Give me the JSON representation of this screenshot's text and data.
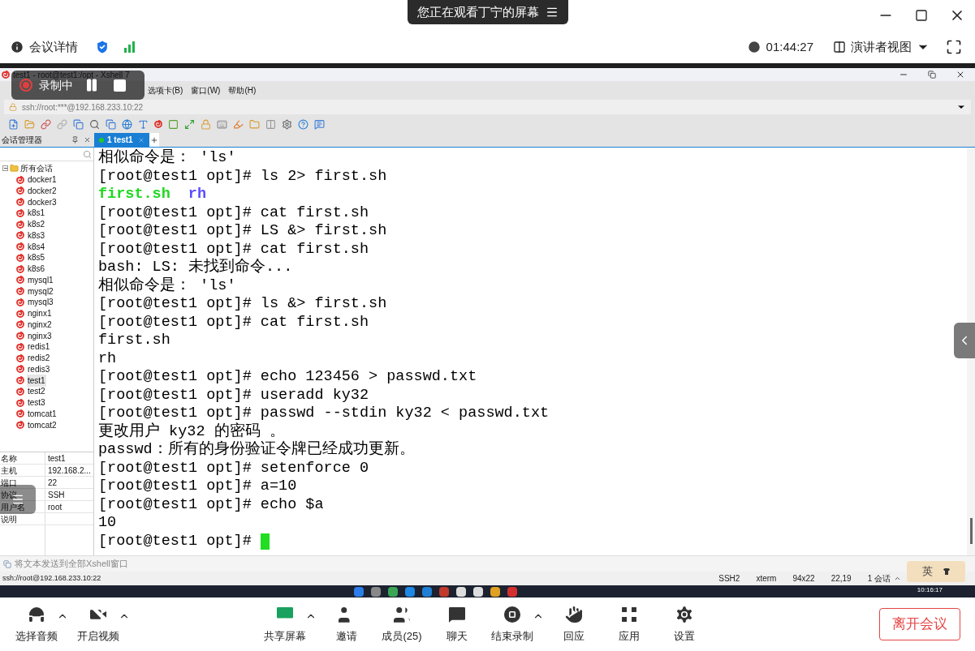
{
  "meeting": {
    "banner": "您正在观看丁宁的屏幕",
    "info": "会议详情",
    "clock": "01:44:27",
    "view": "演讲者视图"
  },
  "recording": {
    "label": "录制中"
  },
  "xshell": {
    "title": "test1 - root@test1:/opt - Xshell 7",
    "menu": [
      "选项卡(B)",
      "窗口(W)",
      "帮助(H)"
    ],
    "address": "ssh://root:***@192.168.233.10:22",
    "sessions_panel": {
      "title": "会话管理器",
      "root": {
        "label": "所有会话",
        "expanded": true,
        "children": [
          {
            "label": "docker1",
            "selected": false
          },
          {
            "label": "docker2",
            "selected": false
          },
          {
            "label": "docker3",
            "selected": false
          },
          {
            "label": "k8s1",
            "selected": false
          },
          {
            "label": "k8s2",
            "selected": false
          },
          {
            "label": "k8s3",
            "selected": false
          },
          {
            "label": "k8s4",
            "selected": false
          },
          {
            "label": "k8s5",
            "selected": false
          },
          {
            "label": "k8s6",
            "selected": false
          },
          {
            "label": "mysql1",
            "selected": false
          },
          {
            "label": "mysql2",
            "selected": false
          },
          {
            "label": "mysql3",
            "selected": false
          },
          {
            "label": "nginx1",
            "selected": false
          },
          {
            "label": "nginx2",
            "selected": false
          },
          {
            "label": "nginx3",
            "selected": false
          },
          {
            "label": "redis1",
            "selected": false
          },
          {
            "label": "redis2",
            "selected": false
          },
          {
            "label": "redis3",
            "selected": false
          },
          {
            "label": "test1",
            "selected": true
          },
          {
            "label": "test2",
            "selected": false
          },
          {
            "label": "test3",
            "selected": false
          },
          {
            "label": "tomcat1",
            "selected": false
          },
          {
            "label": "tomcat2",
            "selected": false
          }
        ]
      }
    },
    "properties": [
      {
        "name": "名称",
        "value": "test1"
      },
      {
        "name": "主机",
        "value": "192.168.2..."
      },
      {
        "name": "端口",
        "value": "22"
      },
      {
        "name": "协议",
        "value": "SSH"
      },
      {
        "name": "用户名",
        "value": "root"
      },
      {
        "name": "说明"
      }
    ],
    "tabs": [
      {
        "label": "1 test1",
        "selected": true
      }
    ],
    "terminal": {
      "lines": [
        {
          "spans": [
            {
              "text": "相似命令是： 'ls'",
              "kind": "text"
            }
          ]
        },
        {
          "spans": [
            {
              "text": "[root@test1 opt]# ls 2> first.sh",
              "kind": "text"
            }
          ]
        },
        {
          "spans": [
            {
              "text": "first.sh",
              "kind": "executable"
            },
            {
              "text": "rh",
              "kind": "directory"
            }
          ]
        },
        {
          "spans": [
            {
              "text": "[root@test1 opt]# cat first.sh",
              "kind": "text"
            }
          ]
        },
        {
          "spans": [
            {
              "text": "[root@test1 opt]# LS &> first.sh",
              "kind": "text"
            }
          ]
        },
        {
          "spans": [
            {
              "text": "[root@test1 opt]# cat first.sh",
              "kind": "text"
            }
          ]
        },
        {
          "spans": [
            {
              "text": "bash: LS: 未找到命令...",
              "kind": "text"
            }
          ]
        },
        {
          "spans": [
            {
              "text": "相似命令是： 'ls'",
              "kind": "text"
            }
          ]
        },
        {
          "spans": [
            {
              "text": "[root@test1 opt]# ls &> first.sh",
              "kind": "text"
            }
          ]
        },
        {
          "spans": [
            {
              "text": "[root@test1 opt]# cat first.sh",
              "kind": "text"
            }
          ]
        },
        {
          "spans": [
            {
              "text": "first.sh",
              "kind": "text"
            }
          ]
        },
        {
          "spans": [
            {
              "text": "rh",
              "kind": "text"
            }
          ]
        },
        {
          "spans": [
            {
              "text": "[root@test1 opt]# echo 123456 > passwd.txt",
              "kind": "text"
            }
          ]
        },
        {
          "spans": [
            {
              "text": "[root@test1 opt]# useradd ky32",
              "kind": "text"
            }
          ]
        },
        {
          "spans": [
            {
              "text": "[root@test1 opt]# passwd --stdin ky32 < passwd.txt",
              "kind": "text"
            }
          ]
        },
        {
          "spans": [
            {
              "text": "更改用户 ky32 的密码 。",
              "kind": "text"
            }
          ]
        },
        {
          "spans": [
            {
              "text": "passwd：所有的身份验证令牌已经成功更新。",
              "kind": "text"
            }
          ]
        },
        {
          "spans": [
            {
              "text": "[root@test1 opt]# setenforce 0",
              "kind": "text"
            }
          ]
        },
        {
          "spans": [
            {
              "text": "[root@test1 opt]# a=10",
              "kind": "text"
            }
          ]
        },
        {
          "spans": [
            {
              "text": "[root@test1 opt]# echo $a",
              "kind": "text"
            }
          ]
        },
        {
          "spans": [
            {
              "text": "10",
              "kind": "text"
            }
          ]
        },
        {
          "spans": [
            {
              "text": "[root@test1 opt]# ",
              "kind": "text"
            }
          ],
          "cursor": true
        }
      ]
    },
    "send_bar": "将文本发送到全部Xshell窗口",
    "status": {
      "address": "ssh://root@192.168.233.10:22",
      "items": [
        "SSH2",
        "xterm",
        "94x22",
        "22,19",
        "1 会话"
      ]
    },
    "ime": "英"
  },
  "taskbar": {
    "time": "10:16:17"
  },
  "toolbar": {
    "buttons": [
      {
        "label": "选择音频",
        "caret": true
      },
      {
        "label": "开启视频",
        "caret": true
      },
      {
        "label": "共享屏幕",
        "caret": true
      },
      {
        "label": "邀请",
        "caret": false
      },
      {
        "label": "成员(25)",
        "caret": false
      },
      {
        "label": "聊天",
        "caret": false
      },
      {
        "label": "结束录制",
        "caret": true
      },
      {
        "label": "回应",
        "caret": false
      },
      {
        "label": "应用",
        "caret": false
      },
      {
        "label": "设置",
        "caret": false
      }
    ],
    "leave": "离开会议"
  }
}
